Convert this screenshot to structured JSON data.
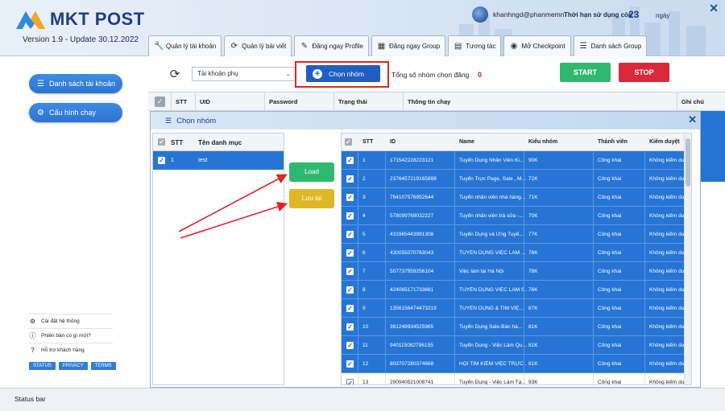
{
  "app": {
    "logo_text": "MKT POST",
    "version": "Version 1.9 - Update 30.12.2022",
    "username": "khanhngd@phanmemn",
    "expire_label": "Thời hạn sử dụng còn :",
    "expire_days": "23",
    "expire_unit": "ngày",
    "close": "✕"
  },
  "tabs": [
    {
      "label": "Quản lý tài khoản",
      "icon": "wrench-icon"
    },
    {
      "label": "Quản lý bài viết",
      "icon": "refresh-doc-icon"
    },
    {
      "label": "Đăng ngay Profile",
      "icon": "pen-icon"
    },
    {
      "label": "Đăng ngay Group",
      "icon": "calendar-icon"
    },
    {
      "label": "Tương tác",
      "icon": "clipboard-icon"
    },
    {
      "label": "Mở Checkpoint",
      "icon": "user-circle-icon"
    },
    {
      "label": "Danh sách Group",
      "icon": "list-icon"
    }
  ],
  "sidebar": {
    "account_list": "Danh sách tài khoản",
    "run_config": "Cấu hình chạy",
    "links": [
      {
        "label": "Cài đặt hệ thống",
        "icon": "gear-icon"
      },
      {
        "label": "Phiên bản có gì mới?",
        "icon": "info-icon"
      },
      {
        "label": "Hỗ trợ khách hàng",
        "icon": "help-icon"
      }
    ],
    "pills": [
      "STATUS",
      "PRIVACY",
      "TERMS"
    ]
  },
  "toolbar": {
    "account_select": "Tài khoản phụ",
    "choose_group": "Chọn nhóm",
    "total_label": "Tổng số nhóm chọn đăng",
    "total_value": "0",
    "start": "START",
    "stop": "STOP"
  },
  "main_table": {
    "columns": [
      "STT",
      "UID",
      "Password",
      "Trạng thái",
      "Thông tin chạy",
      "Ghi chú"
    ]
  },
  "modal": {
    "title": "Chọn nhóm",
    "close": "✕",
    "left_columns": [
      "STT",
      "Tên danh mục"
    ],
    "left_rows": [
      {
        "stt": "1",
        "name": "test"
      }
    ],
    "load": "Load",
    "save": "Lưu lại",
    "right_columns": [
      "STT",
      "ID",
      "Name",
      "Kiểu nhóm",
      "Thành viên",
      "Kiểm duyệt"
    ],
    "rows": [
      {
        "stt": "1",
        "id": "171542228223121",
        "name": "Tuyển Dụng Nhân Viên Ki...",
        "members": "90K",
        "type": "Công khai",
        "review": "Không kiểm duyệt"
      },
      {
        "stt": "2",
        "id": "2376457219165898",
        "name": "Tuyển Trực Page, Sale , M...",
        "members": "72K",
        "type": "Công khai",
        "review": "Không kiểm duyệt"
      },
      {
        "stt": "3",
        "id": "764107576952644",
        "name": "Tuyển nhân viên nhà hàng...",
        "members": "71K",
        "type": "Công khai",
        "review": "Không kiểm duyệt"
      },
      {
        "stt": "4",
        "id": "578099769032227",
        "name": "Tuyển nhân viên trà sữa -...",
        "members": "70K",
        "type": "Công khai",
        "review": "Không kiểm duyệt"
      },
      {
        "stt": "5",
        "id": "431965443991308",
        "name": "Tuyển Dụng và Ứng Tuyể...",
        "members": "77K",
        "type": "Công khai",
        "review": "Không kiểm duyệt"
      },
      {
        "stt": "6",
        "id": "430055070763043",
        "name": "TUYỂN DỤNG VIỆC LÀM ...",
        "members": "76K",
        "type": "Công khai",
        "review": "Không kiểm duyệt"
      },
      {
        "stt": "7",
        "id": "507737959256104",
        "name": "Việc làm tại Hà Nội",
        "members": "78K",
        "type": "Công khai",
        "review": "Không kiểm duyệt"
      },
      {
        "stt": "8",
        "id": "424065171733661",
        "name": "TUYỂN DỤNG VIỆC LÀM S...",
        "members": "76K",
        "type": "Công khai",
        "review": "Không kiểm duyệt"
      },
      {
        "stt": "9",
        "id": "1356156474473219",
        "name": "TUYỂN DỤNG & TÌM VIỆ...",
        "members": "87K",
        "type": "Công khai",
        "review": "Không kiểm duyệt"
      },
      {
        "stt": "10",
        "id": "361248934525965",
        "name": "Tuyển Dụng Sale-Bán hà...",
        "members": "81K",
        "type": "Công khai",
        "review": "Không kiểm duyệt"
      },
      {
        "stt": "11",
        "id": "940115082796155",
        "name": "Tuyển Dụng - Việc Làm Qu...",
        "members": "81K",
        "type": "Công khai",
        "review": "Không kiểm duyệt"
      },
      {
        "stt": "12",
        "id": "803707280374668",
        "name": "HỘI TÌM KIẾM VIỆC TRỰC...",
        "members": "81K",
        "type": "Công khai",
        "review": "Không kiểm duyệt"
      },
      {
        "stt": "13",
        "id": "290940521008741",
        "name": "Tuyển Dụng - Việc Làm Tạ...",
        "members": "93K",
        "type": "Công khai",
        "review": "Không kiểm duyệt"
      }
    ]
  },
  "status_bar": "Status bar",
  "colors": {
    "brand": "#1d3f86",
    "selected_row": "#2675d5",
    "start": "#2fb870",
    "stop": "#d9293b",
    "highlight": "#e02424"
  }
}
